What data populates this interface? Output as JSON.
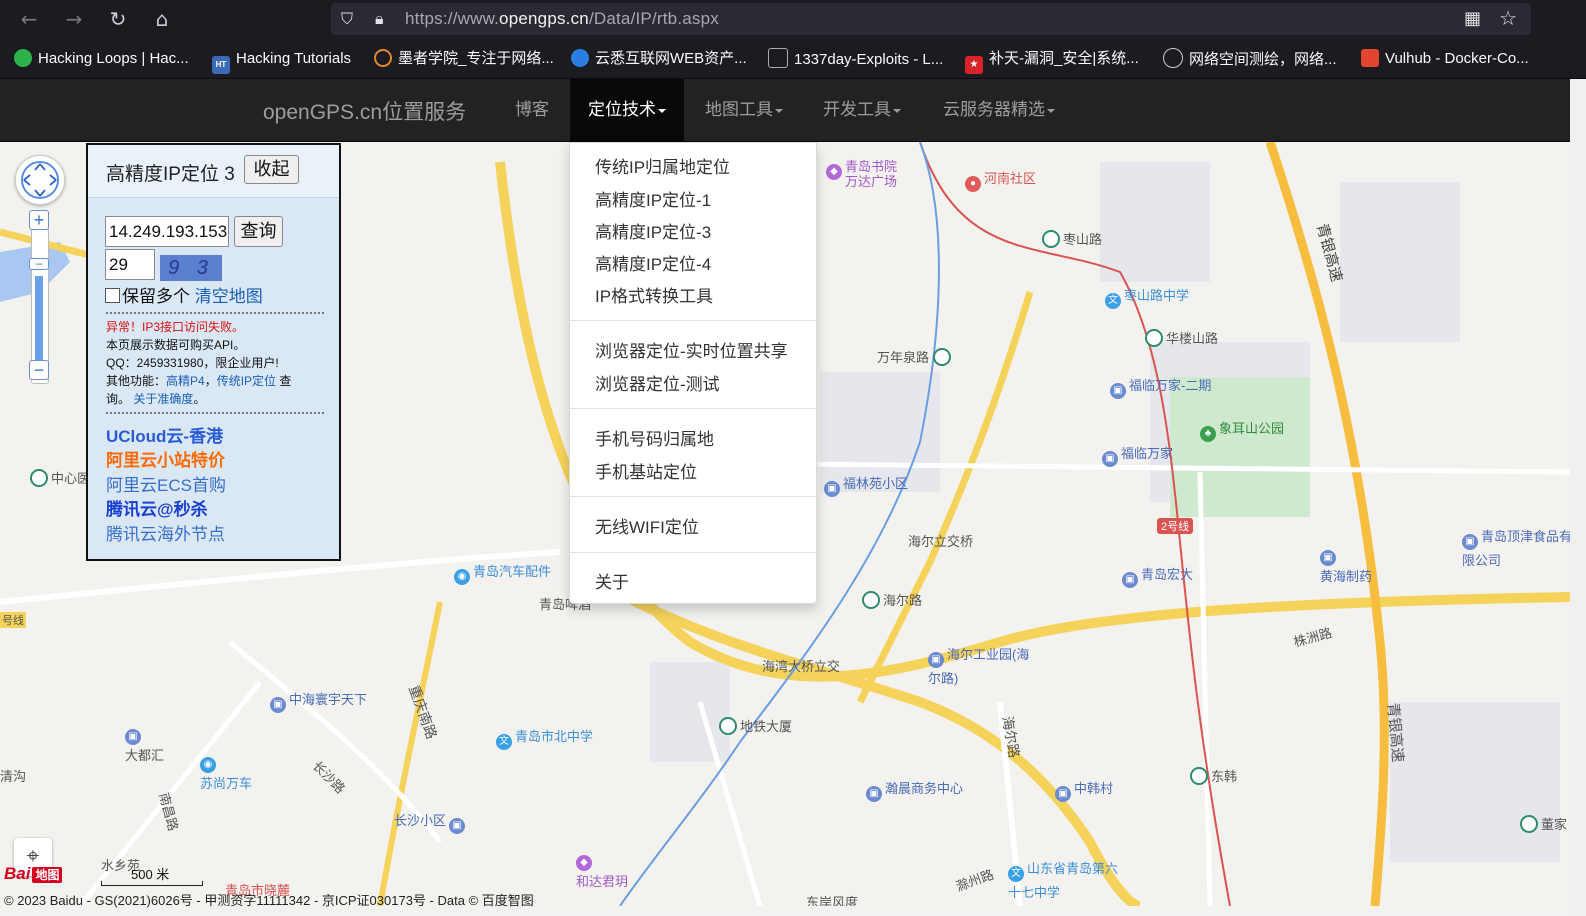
{
  "browser": {
    "url_base": "https://www.",
    "url_host": "opengps.cn",
    "url_path": "/Data/IP/rtb.aspx",
    "bookmarks": [
      "Hacking Loops | Hac...",
      "Hacking Tutorials",
      "墨者学院_专注于网络...",
      "云悉互联网WEB资产...",
      "1337day-Exploits - L...",
      "补天-漏洞_安全|系统...",
      "网络空间测绘，网络...",
      "Vulhub - Docker-Co..."
    ],
    "bookmark_favicon_text": [
      "",
      "HT",
      "",
      "",
      "",
      "",
      "",
      ""
    ]
  },
  "navbar": {
    "brand": "openGPS.cn位置服务",
    "links": [
      "博客",
      "定位技术",
      "地图工具",
      "开发工具",
      "云服务器精选"
    ]
  },
  "dropdown": {
    "items": [
      "传统IP归属地定位",
      "高精度IP定位-1",
      "高精度IP定位-3",
      "高精度IP定位-4",
      "IP格式转换工具",
      "浏览器定位-实时位置共享",
      "浏览器定位-测试",
      "手机号码归属地",
      "手机基站定位",
      "无线WIFI定位",
      "关于"
    ]
  },
  "panel": {
    "title": "高精度IP定位 3",
    "collapse_label": "收起",
    "ip_value": "14.249.193.153",
    "query_label": "查询",
    "code_value": "29",
    "captcha_text": "9 3",
    "keep_multiple_label": "保留多个",
    "clear_map_label": "清空地图",
    "error_text": "异常！IP3接口访问失败。",
    "info_line1": "本页展示数据可购买API。",
    "info_line2": "QQ：2459331980，限企业用户!",
    "info_line3_prefix": "其他功能：",
    "info_link1": "高精P4",
    "info_sep": "，",
    "info_link2": "传统IP定位",
    "info_line3_suffix": " 查",
    "info_line4_prefix": "询。",
    "info_link3": "关于准确度",
    "info_line4_suffix": "。",
    "promos": [
      "UCloud云-香港",
      "阿里云小站特价",
      "阿里云ECS首购",
      "腾讯云@秒杀",
      "腾讯云海外节点"
    ]
  },
  "map": {
    "labels": [
      "青岛书院",
      "万达广场",
      "河南社区",
      "枣山路",
      "枣山路中学",
      "青银高速",
      "华楼山路",
      "万年泉路",
      "福临万家-二期",
      "象耳山公园",
      "福临万家",
      "福林苑小区",
      "中心医",
      "海尔立交桥",
      "2号线",
      "青岛顶津食品有限公司",
      "青岛汽车配件",
      "青岛宏大",
      "黄海制药",
      "青岛啤酒",
      "海尔路",
      "株洲路",
      "海尔工业园(海尔路)",
      "海湾大桥立交",
      "中海寰宇天下",
      "重庆南路",
      "地铁大厦",
      "海尔路",
      "青岛市北中学",
      "大都汇",
      "青银高速",
      "苏尚万车",
      "长沙路",
      "瀚晨商务中心",
      "中韩村",
      "东韩",
      "清沟",
      "南昌路",
      "长沙小区",
      "水乡苑",
      "和达君玥",
      "青岛市晓麓",
      "滁州路",
      "山东省青岛第六十七中学",
      "东岸风度",
      "董家",
      "号线"
    ],
    "scale_label": "500 米",
    "logo_text": "Bai",
    "logo_badge": "地图",
    "copyright": "© 2023 Baidu - GS(2021)6026号 - 甲测资字11111342 - 京ICP证030173号 - Data © 百度智图"
  }
}
